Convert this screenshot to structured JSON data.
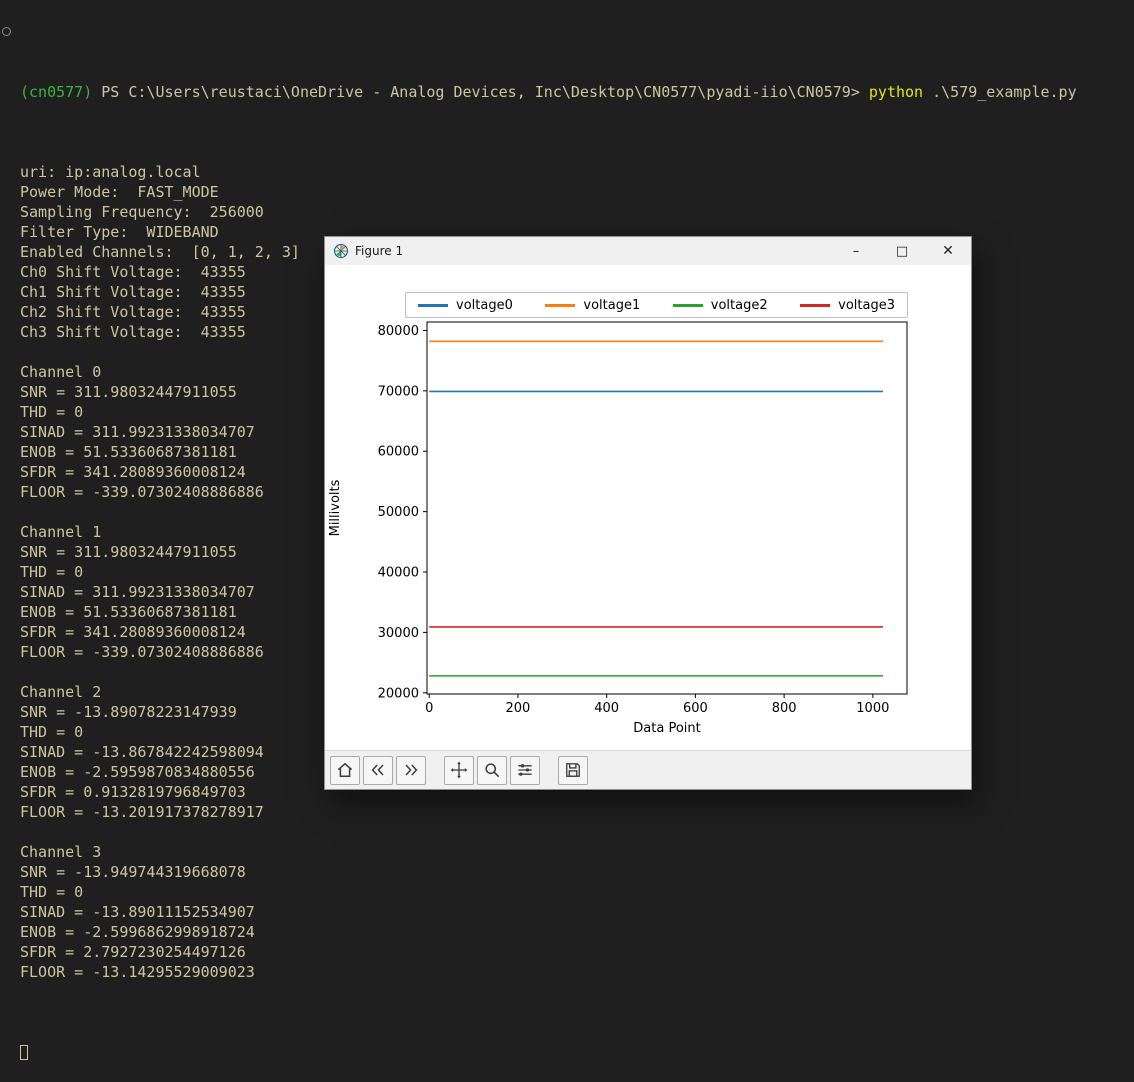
{
  "terminal": {
    "prompt": {
      "venv": "(cn0577) ",
      "shell_path": "PS C:\\Users\\reustaci\\OneDrive - Analog Devices, Inc\\Desktop\\CN0577\\pyadi-iio\\CN0579> ",
      "command": "python ",
      "argument": ".\\579_example.py"
    },
    "output_lines": [
      "uri: ip:analog.local",
      "Power Mode:  FAST_MODE",
      "Sampling Frequency:  256000",
      "Filter Type:  WIDEBAND",
      "Enabled Channels:  [0, 1, 2, 3]",
      "Ch0 Shift Voltage:  43355",
      "Ch1 Shift Voltage:  43355",
      "Ch2 Shift Voltage:  43355",
      "Ch3 Shift Voltage:  43355",
      "",
      "Channel 0",
      "SNR = 311.98032447911055",
      "THD = 0",
      "SINAD = 311.99231338034707",
      "ENOB = 51.53360687381181",
      "SFDR = 341.28089360008124",
      "FLOOR = -339.07302408886886",
      "",
      "Channel 1",
      "SNR = 311.98032447911055",
      "THD = 0",
      "SINAD = 311.99231338034707",
      "ENOB = 51.53360687381181",
      "SFDR = 341.28089360008124",
      "FLOOR = -339.07302408886886",
      "",
      "Channel 2",
      "SNR = -13.89078223147939",
      "THD = 0",
      "SINAD = -13.867842242598094",
      "ENOB = -2.5959870834880556",
      "SFDR = 0.9132819796849703",
      "FLOOR = -13.201917378278917",
      "",
      "Channel 3",
      "SNR = -13.949744319668078",
      "THD = 0",
      "SINAD = -13.89011152534907",
      "ENOB = -2.5996862998918724",
      "SFDR = 2.7927230254497126",
      "FLOOR = -13.14295529009023"
    ],
    "colors": {
      "background": "#1f1f1f",
      "foreground": "#ccc6a0",
      "venv_green": "#3cb43c",
      "command_yellow": "#e5e510"
    }
  },
  "figure_window": {
    "title": "Figure 1",
    "app_icon": "matplotlib-icon",
    "controls": {
      "minimize": "–",
      "maximize": "□",
      "close": "✕"
    },
    "toolbar_buttons": [
      "home",
      "back",
      "forward",
      "pan",
      "zoom",
      "configure-subplots",
      "save"
    ]
  },
  "chart_data": {
    "type": "line",
    "title": "",
    "xlabel": "Data Point",
    "ylabel": "Millivolts",
    "xlim": [
      -5,
      1077
    ],
    "ylim": [
      19800,
      81400
    ],
    "xticks": [
      0,
      200,
      400,
      600,
      800,
      1000
    ],
    "yticks": [
      20000,
      30000,
      40000,
      50000,
      60000,
      70000,
      80000
    ],
    "x_range": [
      0,
      1023
    ],
    "grid": false,
    "legend_position": "top-center",
    "series": [
      {
        "name": "voltage0",
        "color": "#1f77b4",
        "constant_value": 69900
      },
      {
        "name": "voltage1",
        "color": "#ff7f0e",
        "constant_value": 78200
      },
      {
        "name": "voltage2",
        "color": "#2ca02c",
        "constant_value": 22800
      },
      {
        "name": "voltage3",
        "color": "#d62728",
        "constant_value": 30900
      }
    ]
  }
}
